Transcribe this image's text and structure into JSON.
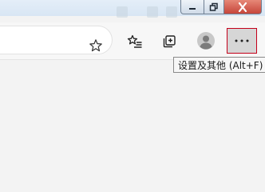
{
  "window_controls": {
    "minimize_icon": "minimize-icon",
    "restore_icon": "restore-icon",
    "close_icon": "close-icon",
    "close_color": "#c6453a"
  },
  "toolbar": {
    "address_bar_icon": "star-outline-icon",
    "favorites_icon": "favorites-list-icon",
    "collections_icon": "collections-icon",
    "profile_icon": "profile-avatar-icon",
    "more_icon": "more-horizontal-icon",
    "more_highlight_color": "#c4001a"
  },
  "tooltip": {
    "text": "设置及其他 (Alt+F)"
  }
}
